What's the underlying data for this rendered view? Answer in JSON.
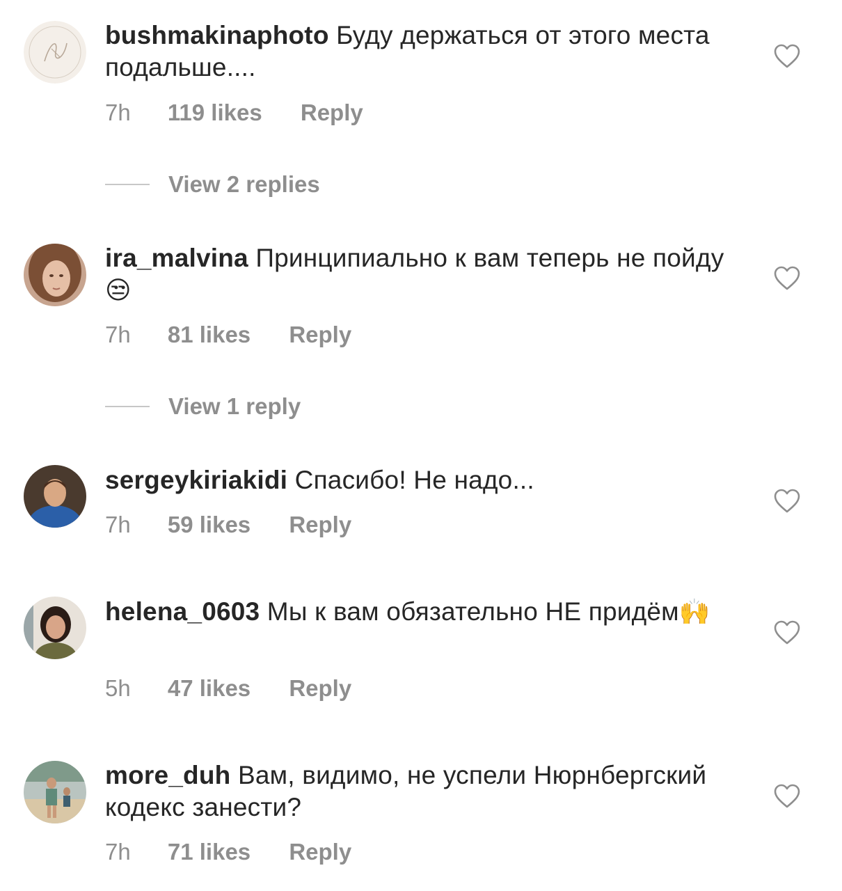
{
  "comments": [
    {
      "username": "bushmakinaphoto",
      "text": "Буду держаться от этого места подальше....",
      "emoji": "",
      "time": "7h",
      "likes": "119 likes",
      "reply": "Reply",
      "view_replies": "View 2 replies",
      "avatar": "logo-avatar"
    },
    {
      "username": "ira_malvina",
      "text": "Принципиально к вам теперь не пойду",
      "emoji": "😒",
      "time": "7h",
      "likes": "81 likes",
      "reply": "Reply",
      "view_replies": "View 1 reply",
      "avatar": "photo-avatar"
    },
    {
      "username": "sergeykiriakidi",
      "text": "Спасибо! Не надо...",
      "emoji": "",
      "time": "7h",
      "likes": "59 likes",
      "reply": "Reply",
      "view_replies": "",
      "avatar": "photo-avatar"
    },
    {
      "username": "helena_0603",
      "text": "Мы к вам обязательно НЕ придём",
      "emoji": "🙌",
      "time": "5h",
      "likes": "47 likes",
      "reply": "Reply",
      "view_replies": "",
      "avatar": "photo-avatar"
    },
    {
      "username": "more_duh",
      "text": "Вам, видимо, не успели Нюрнбергский кодекс занести?",
      "emoji": "",
      "time": "7h",
      "likes": "71 likes",
      "reply": "Reply",
      "view_replies": "",
      "avatar": "photo-avatar"
    }
  ],
  "icons": {
    "like": "heart-outline-icon"
  },
  "colors": {
    "text": "#262626",
    "secondary": "#8e8e8e",
    "divider": "#c7c7c7"
  }
}
